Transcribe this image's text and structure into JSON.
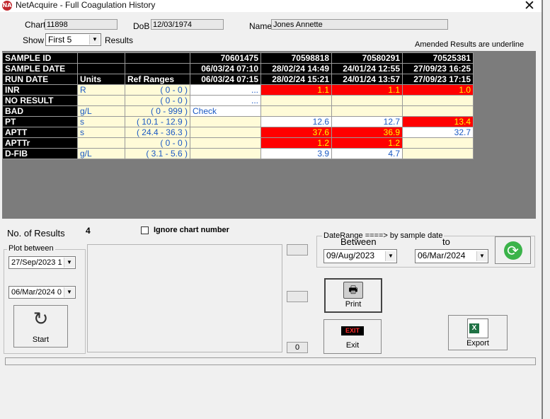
{
  "window": {
    "title": "NetAcquire - Full Coagulation History",
    "icon_text": "NA"
  },
  "header": {
    "chart_label": "Chart",
    "chart_value": "11898",
    "dob_label": "DoB",
    "dob_value": "12/03/1974",
    "name_label": "Name",
    "name_value": "Jones Annette",
    "show_label": "Show",
    "show_value": "First 5",
    "results_label": "Results",
    "amended_note": "Amended  Results are underline"
  },
  "grid": {
    "rows": [
      [
        "SAMPLE ID",
        "",
        "",
        "70601475",
        "70598818",
        "70580291",
        "70525381"
      ],
      [
        "SAMPLE DATE",
        "",
        "",
        "06/03/24 07:10",
        "28/02/24 14:49",
        "24/01/24 12:55",
        "27/09/23 16:25"
      ],
      [
        "RUN DATE",
        "Units",
        "Ref Ranges",
        "06/03/24 07:15",
        "28/02/24 15:21",
        "24/01/24 13:57",
        "27/09/23 17:15"
      ],
      [
        "INR",
        "R",
        "( 0 - 0 )",
        "...",
        "1.1",
        "1.1",
        "1.0"
      ],
      [
        "NO RESULT",
        "",
        "( 0 - 0 )",
        "...",
        "",
        "",
        ""
      ],
      [
        "BAD",
        "g/L",
        "( 0 - 999 )",
        "Check",
        "",
        "",
        ""
      ],
      [
        "PT",
        "s",
        "( 10.1 - 12.9 )",
        "",
        "12.6",
        "12.7",
        "13.4"
      ],
      [
        "APTT",
        "s",
        "( 24.4 - 36.3 )",
        "",
        "37.6",
        "36.9",
        "32.7"
      ],
      [
        "APTTr",
        "",
        "( 0 - 0 )",
        "",
        "1.2",
        "1.2",
        ""
      ],
      [
        "D-FIB",
        "g/L",
        "( 3.1 - 5.6 )",
        "",
        "3.9",
        "4.7",
        ""
      ]
    ]
  },
  "results": {
    "count_label": "No. of Results",
    "count_value": "4",
    "ignore_label": "Ignore chart number"
  },
  "plot": {
    "title": "Plot between",
    "from": "27/Sep/2023 1",
    "to": "06/Mar/2024 0",
    "start_label": "Start",
    "box1": "",
    "box2": "",
    "box3": "0"
  },
  "daterange": {
    "title": "DateRange ====> by sample date",
    "between_label": "Between",
    "to_label": "to",
    "from_value": "09/Aug/2023",
    "to_value": "06/Mar/2024"
  },
  "buttons": {
    "print": "Print",
    "exit": "Exit",
    "exit_sign": "EXIT",
    "export": "Export"
  },
  "colors": {
    "abnormal_bg": "#ff0000",
    "abnormal_text": "#ffff00",
    "value_blue": "#1a59c4",
    "cream": "#fffbd8"
  }
}
